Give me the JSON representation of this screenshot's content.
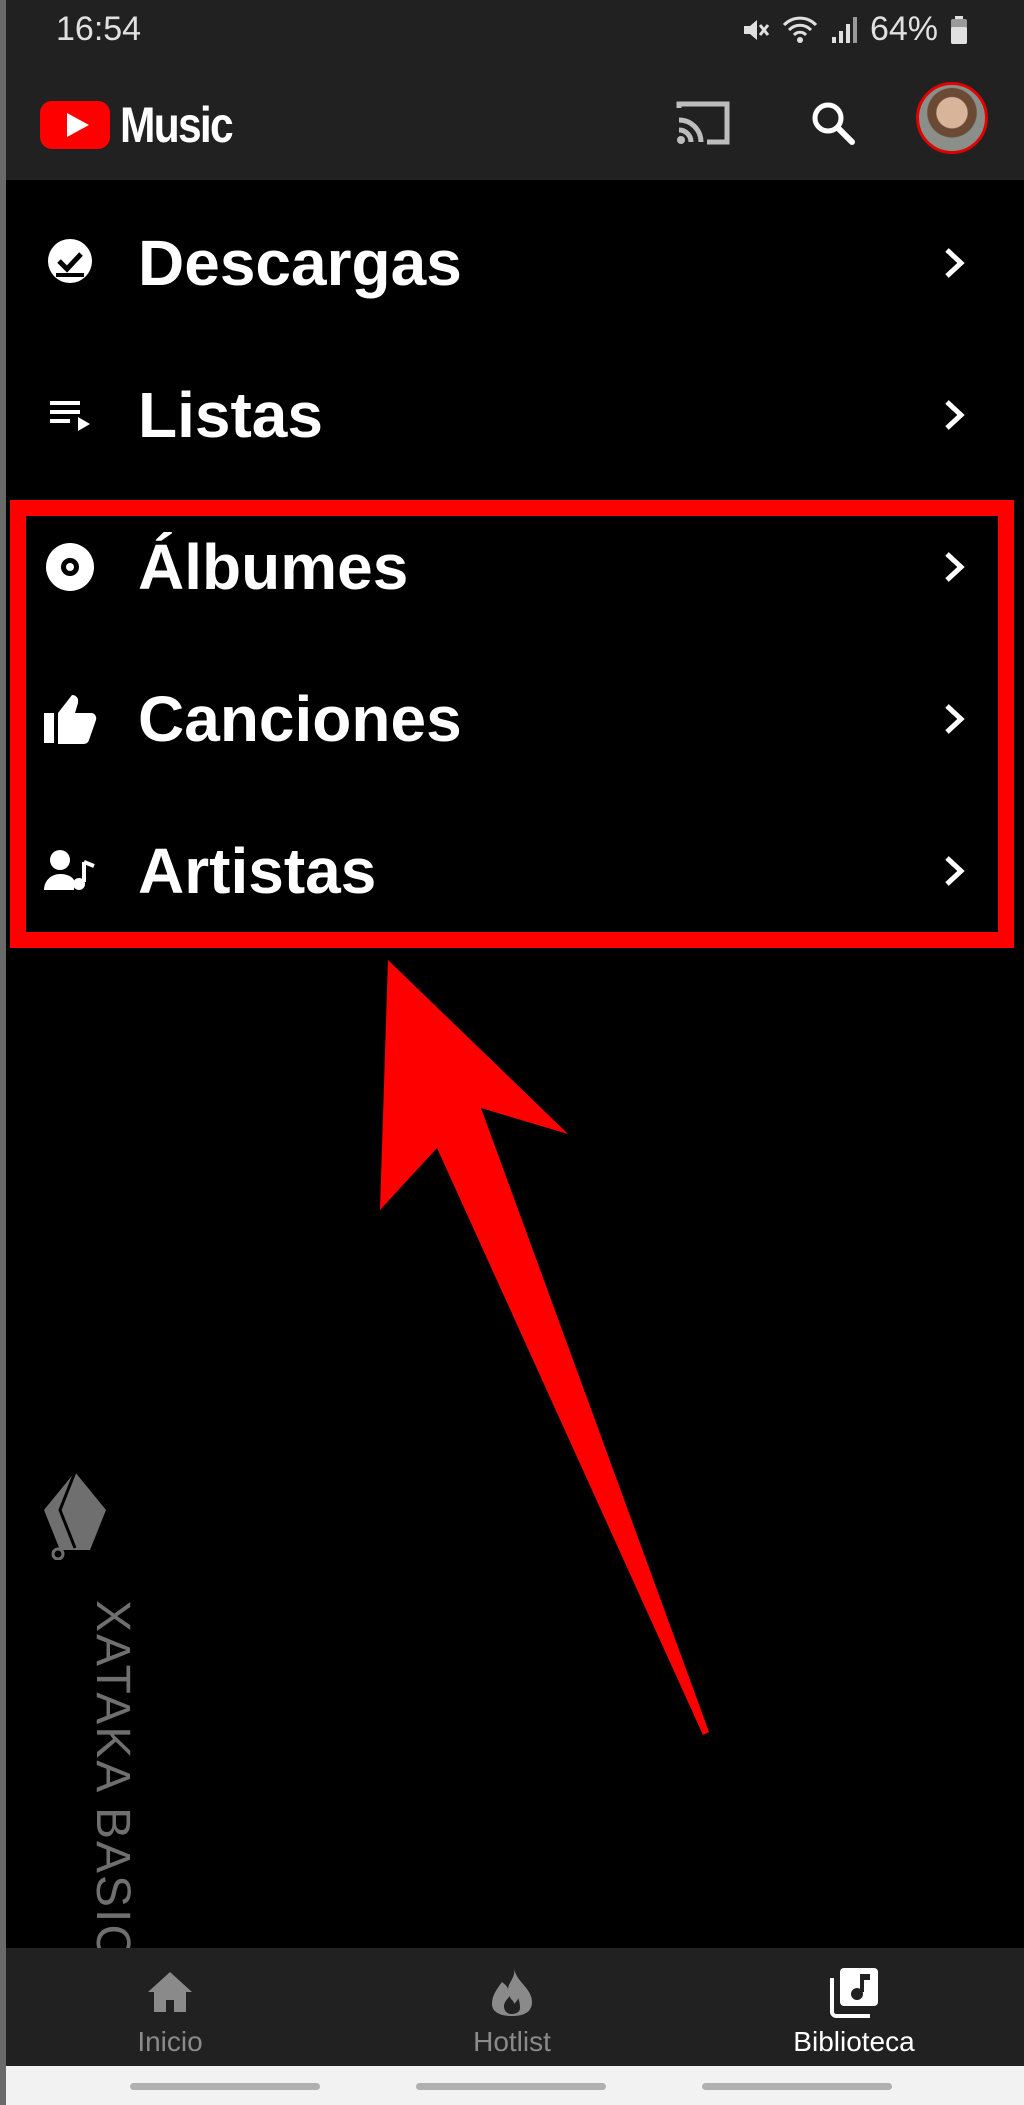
{
  "status_bar": {
    "time": "16:54",
    "battery": "64%",
    "icons": [
      "mute-icon",
      "wifi-icon",
      "signal-icon",
      "battery-icon"
    ]
  },
  "header": {
    "app_name": "Music",
    "icons": [
      "youtube-music-logo",
      "cast-icon",
      "search-icon",
      "avatar"
    ]
  },
  "library": {
    "items": [
      {
        "label": "Descargas",
        "icon": "download-done-icon"
      },
      {
        "label": "Listas",
        "icon": "playlist-icon"
      },
      {
        "label": "Álbumes",
        "icon": "album-icon"
      },
      {
        "label": "Canciones",
        "icon": "thumb-up-icon"
      },
      {
        "label": "Artistas",
        "icon": "artist-icon"
      }
    ]
  },
  "watermark": {
    "text": "XATAKA BASICS"
  },
  "bottom_nav": {
    "items": [
      {
        "label": "Inicio",
        "icon": "home-icon",
        "active": false
      },
      {
        "label": "Hotlist",
        "icon": "fire-icon",
        "active": false
      },
      {
        "label": "Biblioteca",
        "icon": "library-music-icon",
        "active": true
      }
    ]
  },
  "colors": {
    "background": "#000000",
    "bar_background": "#212121",
    "annotation_red": "#ff0000",
    "brand_red": "#ff0000"
  }
}
